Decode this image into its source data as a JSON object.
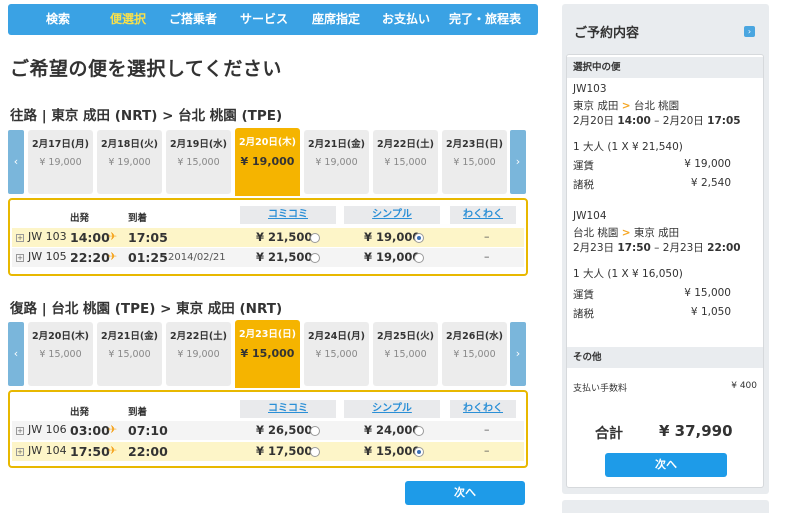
{
  "nav": {
    "items": [
      {
        "label": "検索"
      },
      {
        "label": "便選択"
      },
      {
        "label": "ご搭乗者"
      },
      {
        "label": "サービス"
      },
      {
        "label": "座席指定"
      },
      {
        "label": "お支払い"
      },
      {
        "label": "完了・旅程表"
      }
    ],
    "active_index": 1,
    "active_color": "#f8e04b"
  },
  "page_title": "ご希望の便を選択してください",
  "outbound": {
    "title": "往路 | 東京 成田 (NRT) > 台北 桃園 (TPE)",
    "dates": [
      {
        "date": "2月17日(月)",
        "price": "¥ 19,000"
      },
      {
        "date": "2月18日(火)",
        "price": "¥ 19,000"
      },
      {
        "date": "2月19日(水)",
        "price": "¥ 15,000"
      },
      {
        "date": "2月20日(木)",
        "price": "¥ 19,000"
      },
      {
        "date": "2月21日(金)",
        "price": "¥ 19,000"
      },
      {
        "date": "2月22日(土)",
        "price": "¥ 15,000"
      },
      {
        "date": "2月23日(日)",
        "price": "¥ 15,000"
      }
    ],
    "selected_date_index": 3,
    "headers": {
      "depart": "出発",
      "arrive": "到着",
      "fare1": "コミコミ",
      "fare2": "シンプル",
      "fare3": "わくわく"
    },
    "flights": [
      {
        "flight": "JW 103",
        "dep": "14:00",
        "arr": "17:05",
        "arr_date": "",
        "fare1": "¥ 21,500",
        "fare2": "¥ 19,000",
        "fare3": "–"
      },
      {
        "flight": "JW 105",
        "dep": "22:20",
        "arr": "01:25",
        "arr_date": "2014/02/21",
        "fare1": "¥ 21,500",
        "fare2": "¥ 19,000",
        "fare3": "–"
      }
    ]
  },
  "return": {
    "title": "復路 | 台北 桃園 (TPE) > 東京 成田 (NRT)",
    "dates": [
      {
        "date": "2月20日(木)",
        "price": "¥ 15,000"
      },
      {
        "date": "2月21日(金)",
        "price": "¥ 15,000"
      },
      {
        "date": "2月22日(土)",
        "price": "¥ 19,000"
      },
      {
        "date": "2月23日(日)",
        "price": "¥ 15,000"
      },
      {
        "date": "2月24日(月)",
        "price": "¥ 15,000"
      },
      {
        "date": "2月25日(火)",
        "price": "¥ 15,000"
      },
      {
        "date": "2月26日(水)",
        "price": "¥ 15,000"
      }
    ],
    "selected_date_index": 3,
    "headers": {
      "depart": "出発",
      "arrive": "到着",
      "fare1": "コミコミ",
      "fare2": "シンプル",
      "fare3": "わくわく"
    },
    "flights": [
      {
        "flight": "JW 106",
        "dep": "03:00",
        "arr": "07:10",
        "arr_date": "",
        "fare1": "¥ 26,500",
        "fare2": "¥ 24,000",
        "fare3": "–"
      },
      {
        "flight": "JW 104",
        "dep": "17:50",
        "arr": "22:00",
        "arr_date": "",
        "fare1": "¥ 17,500",
        "fare2": "¥ 15,000",
        "fare3": "–"
      }
    ]
  },
  "next_label": "次へ",
  "sidebar": {
    "title": "ご予約内容",
    "selected_section": "選択中の便",
    "outbound": {
      "flight": "JW103",
      "route_from": "東京 成田",
      "route_to": "台北 桃園",
      "schedule_date1": "2月20日",
      "schedule_time1": "14:00",
      "schedule_date2": "2月20日",
      "schedule_time2": "17:05",
      "pax": "1 大人 (1 X ¥ 21,540)",
      "fare_label": "運賃",
      "fare": "¥ 19,000",
      "tax_label": "諸税",
      "tax": "¥ 2,540"
    },
    "return": {
      "flight": "JW104",
      "route_from": "台北 桃園",
      "route_to": "東京 成田",
      "schedule_date1": "2月23日",
      "schedule_time1": "17:50",
      "schedule_date2": "2月23日",
      "schedule_time2": "22:00",
      "pax": "1 大人 (1 X ¥ 16,050)",
      "fare_label": "運賃",
      "fare": "¥ 15,000",
      "tax_label": "諸税",
      "tax": "¥ 1,050"
    },
    "other_section": "その他",
    "fee_label": "支払い手数料",
    "fee": "¥ 400",
    "total_label": "合計",
    "total": "¥ 37,990",
    "next_label": "次へ"
  }
}
